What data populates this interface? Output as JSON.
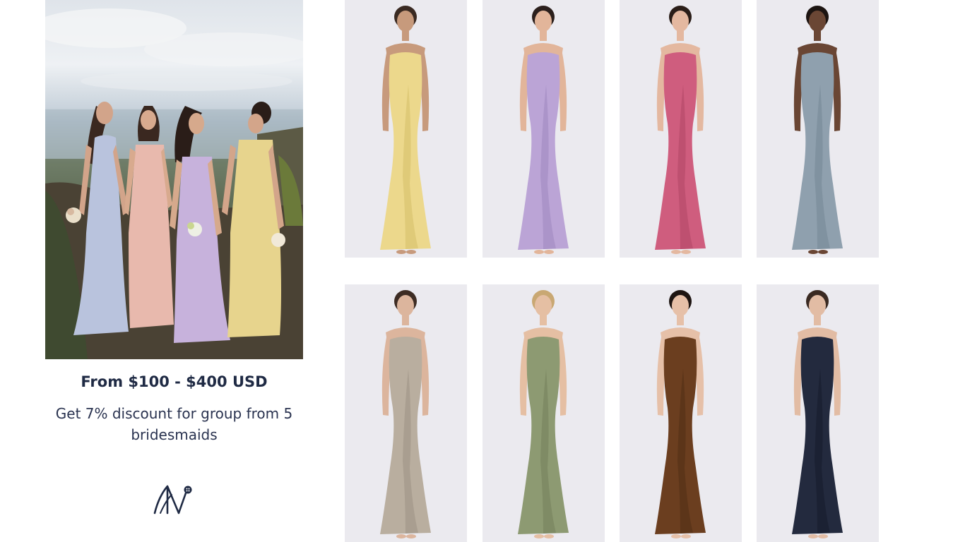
{
  "promo": {
    "price": "From $100 - $400 USD",
    "discount": "Get 7% discount for group from 5 bridesmaids"
  },
  "hero": {
    "dress_colors": [
      "#b9c3dd",
      "#e8b9ad",
      "#c7b2dc",
      "#e7d48d"
    ]
  },
  "logo": {
    "icon": "brand-monogram-icon",
    "color": "#1f2a44"
  },
  "products": [
    {
      "color": "#ecd88c",
      "shade": "#d6bf67",
      "skin": "#c79a7c",
      "hair": "#3a2a22"
    },
    {
      "color": "#bba4d6",
      "shade": "#9f86c0",
      "skin": "#e2b59a",
      "hair": "#2b1f1c"
    },
    {
      "color": "#cf5d7e",
      "shade": "#b04565",
      "skin": "#e4b8a0",
      "hair": "#2a1d18"
    },
    {
      "color": "#8fa0ae",
      "shade": "#748696",
      "skin": "#6a4634",
      "hair": "#1c1411"
    },
    {
      "color": "#b9ae9f",
      "shade": "#9d9283",
      "skin": "#dcb59d",
      "hair": "#3d2c24"
    },
    {
      "color": "#8d9a72",
      "shade": "#74805b",
      "skin": "#e5bfa3",
      "hair": "#c9a873"
    },
    {
      "color": "#6b3e1f",
      "shade": "#512d14",
      "skin": "#e6c0a8",
      "hair": "#1e1512"
    },
    {
      "color": "#232a3e",
      "shade": "#151a2a",
      "skin": "#e2bca4",
      "hair": "#3a2a22"
    }
  ]
}
